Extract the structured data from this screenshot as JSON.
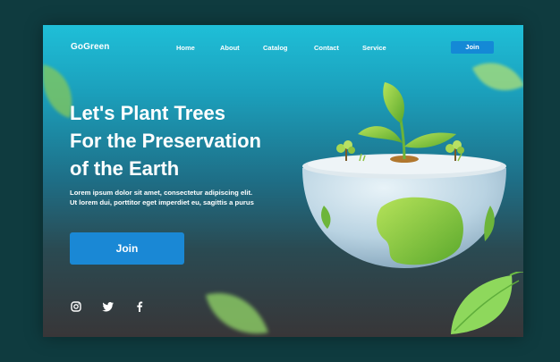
{
  "nav": {
    "logo": "GoGreen",
    "links": [
      "Home",
      "About",
      "Catalog",
      "Contact",
      "Service"
    ],
    "join_label": "Join"
  },
  "hero": {
    "headline_lines": [
      "Let's Plant Trees",
      "For the Preservation",
      "of the Earth"
    ],
    "description_lines": [
      "Lorem ipsum dolor sit amet, consectetur adipiscing elit.",
      "Ut lorem dui, porttitor eget imperdiet eu, sagittis a purus"
    ],
    "cta_label": "Join"
  },
  "social": {
    "icons": [
      "instagram-icon",
      "twitter-icon",
      "facebook-icon"
    ]
  },
  "colors": {
    "accent_blue": "#1a88d5",
    "leaf_green": "#7cc242",
    "gradient_top": "#1fbfd8",
    "gradient_bottom": "#383638"
  }
}
